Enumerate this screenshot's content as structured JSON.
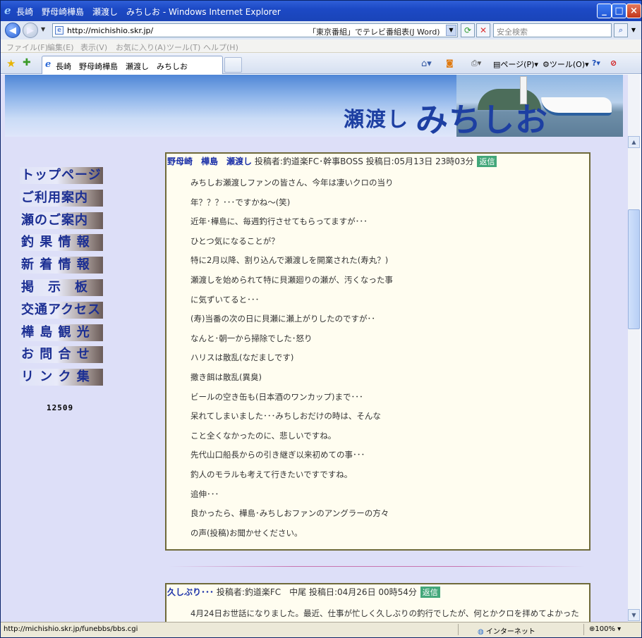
{
  "window": {
    "title": "長崎　野母崎樺島　瀬渡し　みちしお - Windows Internet Explorer"
  },
  "address_bar": {
    "url": "http://michishio.skr.jp/",
    "ad_text": "「東京番組」でテレビ番組表(J Word)",
    "search_placeholder": "安全検索"
  },
  "menu": [
    "ファイル(F)",
    "編集(E)",
    "表示(V)",
    "お気に入り(A)",
    "ツール(T)",
    "ヘルプ(H)"
  ],
  "tab": {
    "label": "長崎　野母崎樺島　瀬渡し　みちしお"
  },
  "toolbar": {
    "page_label": "ページ(P)",
    "tools_label": "ツール(O)"
  },
  "banner": {
    "title_small": "瀬渡し",
    "title_large": "みちしお"
  },
  "nav": [
    "トップページ",
    "ご利用案内",
    "瀬のご案内",
    "釣 果 情 報",
    "新 着 情 報",
    "掲　示　板",
    "交通アクセス",
    "樺 島 観 光",
    "お 問 合 せ",
    "リ ン ク 集"
  ],
  "counter": "12509",
  "posts": [
    {
      "title": "野母崎　樺島　瀬渡し",
      "meta": "投稿者:釣道楽FC･幹事BOSS 投稿日:05月13日 23時03分",
      "reply": "返信",
      "lines": [
        "みちしお瀬渡しファンの皆さん、今年は凄いクロの当り",
        "年？？？･･･ですかね～(笑)",
        "近年･樺島に、毎週釣行させてもらってますが･･･",
        "ひとつ気になることが？",
        "特に2月以降、割り込んで瀬渡しを開業された(寿丸？)",
        "瀬渡しを始められて特に貝瀬廻りの瀬が、汚くなった事",
        "に気ずいてると･･･",
        "(寿)当番の次の日に貝瀬に瀬上がりしたのですが･･",
        "なんと･朝一から掃除でした･怒り",
        "ハリスは散乱(なだましです)",
        "撒き餌は散乱(異臭)",
        "ビールの空き缶も(日本酒のワンカップ)まで･･･",
        "呆れてしまいました･･･みちしおだけの時は、そんな",
        "こと全くなかったのに、悲しいですね。",
        "先代山口船長からの引き継ぎ以来初めての事･･･",
        "釣人のモラルも考えて行きたいですですね。",
        "追伸･･･",
        "良かったら、樺島･みちしおファンのアングラーの方々",
        "の声(投稿)お聞かせください。"
      ]
    },
    {
      "title": "久しぶり･･･",
      "meta": "投稿者:釣道楽FC　中尾 投稿日:04月26日 00時54分",
      "reply": "返信",
      "lines": [
        "4月24日お世話になりました。最近、仕事が忙しく久しぶりの釣行でしたが、何とかクロを拝めてよかった"
      ]
    }
  ],
  "status": {
    "url": "http://michishio.skr.jp/funebbs/bbs.cgi",
    "zone": "インターネット",
    "zoom": "100%"
  },
  "colors": {
    "nav_text": "#1c2f93",
    "post_title": "#1a2fa8",
    "reply_badge": "#43a77a",
    "page_bg": "#dddff8"
  }
}
